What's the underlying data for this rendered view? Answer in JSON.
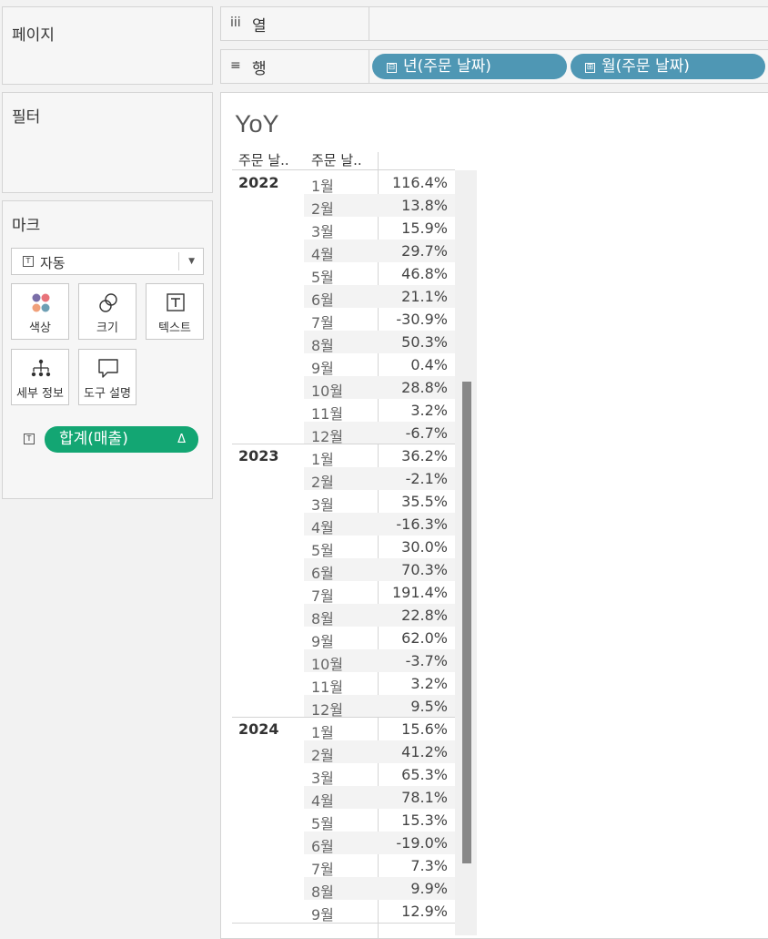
{
  "cards": {
    "pages": "페이지",
    "filters": "필터",
    "marks": "마크"
  },
  "shelves": {
    "columns": {
      "icon": "iii",
      "label": "열"
    },
    "rows": {
      "icon": "≡",
      "label": "행"
    },
    "row_pills": [
      {
        "toggle": "⊟",
        "label": "년(주문 날짜)"
      },
      {
        "toggle": "⊞",
        "label": "월(주문 날짜)"
      }
    ]
  },
  "marks": {
    "type_icon": "T",
    "type_label": "자동",
    "buttons": {
      "color": "색상",
      "size": "크기",
      "text": "텍스트",
      "detail": "세부 정보",
      "tooltip": "도구 설명"
    },
    "field_icon": "T",
    "field_pill": "합계(매출)",
    "field_delta": "Δ",
    "accent_green": "#13a673",
    "accent_blue": "#4f97b4"
  },
  "view": {
    "title": "YoY",
    "headers": [
      "주문 날..",
      "주문 날.."
    ],
    "groups": [
      {
        "year": "2022",
        "rows": [
          {
            "month": "1월",
            "value": "116.4%"
          },
          {
            "month": "2월",
            "value": "13.8%"
          },
          {
            "month": "3월",
            "value": "15.9%"
          },
          {
            "month": "4월",
            "value": "29.7%"
          },
          {
            "month": "5월",
            "value": "46.8%"
          },
          {
            "month": "6월",
            "value": "21.1%"
          },
          {
            "month": "7월",
            "value": "-30.9%"
          },
          {
            "month": "8월",
            "value": "50.3%"
          },
          {
            "month": "9월",
            "value": "0.4%"
          },
          {
            "month": "10월",
            "value": "28.8%"
          },
          {
            "month": "11월",
            "value": "3.2%"
          },
          {
            "month": "12월",
            "value": "-6.7%"
          }
        ]
      },
      {
        "year": "2023",
        "rows": [
          {
            "month": "1월",
            "value": "36.2%"
          },
          {
            "month": "2월",
            "value": "-2.1%"
          },
          {
            "month": "3월",
            "value": "35.5%"
          },
          {
            "month": "4월",
            "value": "-16.3%"
          },
          {
            "month": "5월",
            "value": "30.0%"
          },
          {
            "month": "6월",
            "value": "70.3%"
          },
          {
            "month": "7월",
            "value": "191.4%"
          },
          {
            "month": "8월",
            "value": "22.8%"
          },
          {
            "month": "9월",
            "value": "62.0%"
          },
          {
            "month": "10월",
            "value": "-3.7%"
          },
          {
            "month": "11월",
            "value": "3.2%"
          },
          {
            "month": "12월",
            "value": "9.5%"
          }
        ]
      },
      {
        "year": "2024",
        "rows": [
          {
            "month": "1월",
            "value": "15.6%"
          },
          {
            "month": "2월",
            "value": "41.2%"
          },
          {
            "month": "3월",
            "value": "65.3%"
          },
          {
            "month": "4월",
            "value": "78.1%"
          },
          {
            "month": "5월",
            "value": "15.3%"
          },
          {
            "month": "6월",
            "value": "-19.0%"
          },
          {
            "month": "7월",
            "value": "7.3%"
          },
          {
            "month": "8월",
            "value": "9.9%"
          },
          {
            "month": "9월",
            "value": "12.9%"
          }
        ]
      }
    ]
  }
}
